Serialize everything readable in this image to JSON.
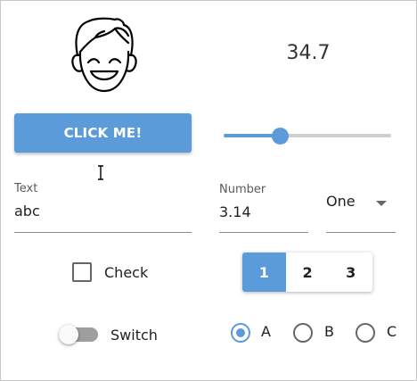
{
  "display": {
    "value": "34.7"
  },
  "button": {
    "label": "CLICK ME!"
  },
  "slider": {
    "value_fraction": 0.34,
    "accent": "#5b9bd9"
  },
  "text_field": {
    "label": "Text",
    "value": "abc"
  },
  "number_field": {
    "label": "Number",
    "value": "3.14"
  },
  "select": {
    "value": "One"
  },
  "checkbox": {
    "label": "Check",
    "checked": false
  },
  "segmented": {
    "items": [
      "1",
      "2",
      "3"
    ],
    "selected": "1"
  },
  "switch": {
    "label": "Switch",
    "on": false
  },
  "radios": {
    "items": [
      "A",
      "B",
      "C"
    ],
    "selected": "A"
  },
  "icons": {
    "face": "smiling-face-icon",
    "cursor": "text-cursor-icon",
    "dropdown": "caret-down-icon"
  }
}
